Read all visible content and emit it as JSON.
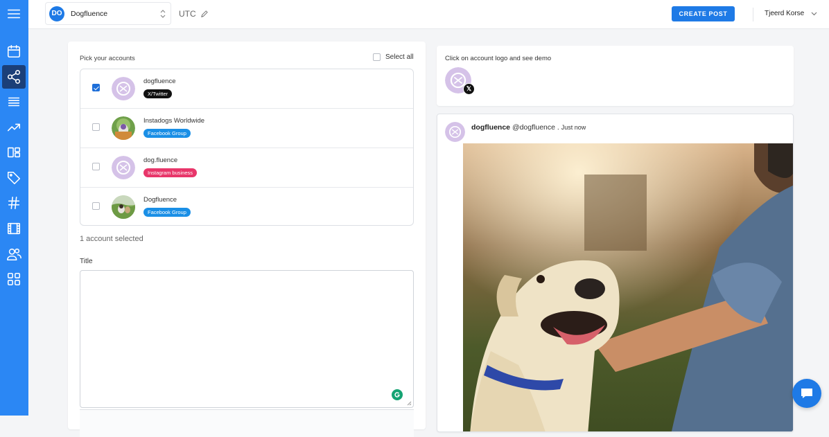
{
  "sidebar": {
    "items": [
      {
        "name": "menu-icon"
      },
      {
        "name": "calendar-icon"
      },
      {
        "name": "share-icon",
        "active": true
      },
      {
        "name": "list-icon"
      },
      {
        "name": "trending-up-icon"
      },
      {
        "name": "layout-icon"
      },
      {
        "name": "tag-icon"
      },
      {
        "name": "hashtag-icon"
      },
      {
        "name": "film-icon"
      },
      {
        "name": "users-icon"
      },
      {
        "name": "grid-icon"
      }
    ],
    "color": "#2b87f4"
  },
  "header": {
    "workspace": {
      "initials": "DO",
      "name": "Dogfluence"
    },
    "timezone": "UTC",
    "create_label": "CREATE POST",
    "user_name": "Tjeerd Korse"
  },
  "accounts": {
    "heading": "Pick your accounts",
    "select_all_label": "Select all",
    "items": [
      {
        "name": "dogfluence",
        "network": "X/Twitter",
        "checked": true
      },
      {
        "name": "Instadogs Worldwide",
        "network": "Facebook Group",
        "checked": false
      },
      {
        "name": "dog.fluence",
        "network": "Instagram business",
        "checked": false
      },
      {
        "name": "Dogfluence",
        "network": "Facebook Group",
        "checked": false
      }
    ],
    "selected_count_text": "1 account selected"
  },
  "title_field": {
    "label": "Title",
    "value": ""
  },
  "preview": {
    "demo_label": "Click on account logo and see demo",
    "display_name": "dogfluence",
    "handle": "@dogfluence",
    "separator": ".",
    "time": "Just now"
  },
  "colors": {
    "accent": "#1e7ae6",
    "twitter_tag": "#111111",
    "facebook_tag": "#1a8fe6",
    "instagram_tag": "#e8366a"
  }
}
